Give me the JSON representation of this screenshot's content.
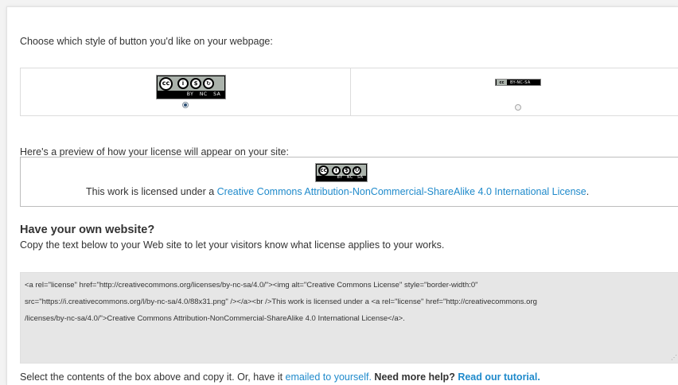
{
  "choose_style_text": "Choose which style of button you'd like on your webpage:",
  "style_options": {
    "large_badge": {
      "cc": "cc",
      "labels": [
        "BY",
        "NC",
        "SA"
      ],
      "selected": true
    },
    "small_badge": {
      "cc": "cc",
      "label": "BY-NC-SA",
      "selected": false
    }
  },
  "preview": {
    "intro": "Here's a preview of how your license will appear on your site:",
    "prefix": "This work is licensed under a ",
    "link_text": "Creative Commons Attribution-NonCommercial-ShareAlike 4.0 International License",
    "suffix": "."
  },
  "own_website": {
    "heading": "Have your own website?",
    "description": "Copy the text below to your Web site to let your visitors know what license applies to your works."
  },
  "code_snippet": "<a rel=\"license\" href=\"http://creativecommons.org/licenses/by-nc-sa/4.0/\"><img alt=\"Creative Commons License\" style=\"border-width:0\"\nsrc=\"https://i.creativecommons.org/l/by-nc-sa/4.0/88x31.png\" /></a><br />This work is licensed under a <a rel=\"license\" href=\"http://creativecommons.org\n/licenses/by-nc-sa/4.0/\">Creative Commons Attribution-NonCommercial-ShareAlike 4.0 International License</a>.",
  "footer": {
    "prefix": "Select the contents of the box above and copy it. Or, have it ",
    "email_link": "emailed to yourself.",
    "help_text": "Need more help?",
    "tutorial_link": "Read our tutorial."
  },
  "colors": {
    "link": "#1f8acb",
    "code_bg": "#e6e6e6"
  }
}
